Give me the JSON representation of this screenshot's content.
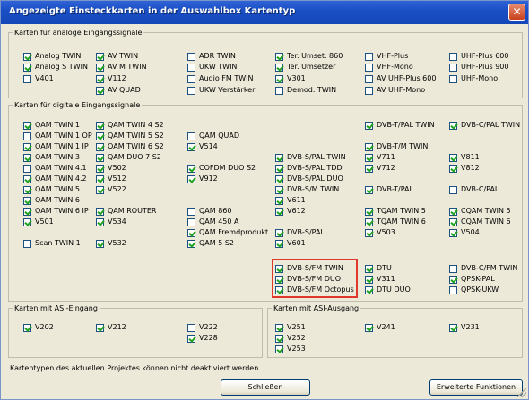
{
  "window": {
    "title": "Angezeigte Einsteckkarten in der Auswahlbox Kartentyp",
    "close_glyph": "✕"
  },
  "groups": {
    "analog": "Karten für analoge Eingangssignale",
    "digital": "Karten für digitale Eingangssignale",
    "asi_in": "Karten mit ASI-Eingang",
    "asi_out": "Karten mit ASI-Ausgang"
  },
  "analog_items": [
    {
      "label": "Analog TWIN",
      "checked": true
    },
    {
      "label": "Analog S TWIN",
      "checked": true
    },
    {
      "label": "V401",
      "checked": false
    },
    {
      "label": "AV TWIN",
      "checked": true
    },
    {
      "label": "AV M TWIN",
      "checked": true
    },
    {
      "label": "V112",
      "checked": true
    },
    {
      "label": "AV QUAD",
      "checked": true
    },
    {
      "label": "ADR TWIN",
      "checked": false
    },
    {
      "label": "UKW TWIN",
      "checked": false
    },
    {
      "label": "Audio FM TWIN",
      "checked": false
    },
    {
      "label": "UKW Verstärker",
      "checked": false
    },
    {
      "label": "Ter. Umset. 860",
      "checked": true
    },
    {
      "label": "Ter. Umsetzer",
      "checked": true
    },
    {
      "label": "V301",
      "checked": true
    },
    {
      "label": "Demod. TWIN",
      "checked": false
    },
    {
      "label": "VHF-Plus",
      "checked": false
    },
    {
      "label": "VHF-Mono",
      "checked": false
    },
    {
      "label": "AV UHF-Plus 600",
      "checked": false
    },
    {
      "label": "AV UHF-Mono",
      "checked": false
    },
    {
      "label": "UHF-Plus 600",
      "checked": false
    },
    {
      "label": "UHF-Plus 900",
      "checked": false
    },
    {
      "label": "UHF-Mono",
      "checked": false
    }
  ],
  "digital_items": [
    {
      "label": "QAM TWIN 1",
      "checked": true
    },
    {
      "label": "QAM TWIN 1 OP",
      "checked": false
    },
    {
      "label": "QAM TWIN 1 IP",
      "checked": true
    },
    {
      "label": "QAM TWIN 3",
      "checked": true
    },
    {
      "label": "QAM TWIN 4.1",
      "checked": false
    },
    {
      "label": "QAM TWIN 4.2",
      "checked": true
    },
    {
      "label": "QAM TWIN 5",
      "checked": true
    },
    {
      "label": "QAM TWIN 6",
      "checked": true
    },
    {
      "label": "QAM TWIN 6 IP",
      "checked": true
    },
    {
      "label": "V501",
      "checked": true
    },
    {
      "label": "Scan TWIN 1",
      "checked": false
    },
    {
      "label": "QAM TWIN 4 S2",
      "checked": true
    },
    {
      "label": "QAM TWIN 5 S2",
      "checked": true
    },
    {
      "label": "QAM TWIN 6 S2",
      "checked": true
    },
    {
      "label": "QAM DUO 7 S2",
      "checked": true
    },
    {
      "label": "V502",
      "checked": true
    },
    {
      "label": "V512",
      "checked": true
    },
    {
      "label": "V522",
      "checked": true
    },
    {
      "label": "QAM ROUTER",
      "checked": true
    },
    {
      "label": "V534",
      "checked": true
    },
    {
      "label": "V532",
      "checked": true
    },
    {
      "label": "QAM QUAD",
      "checked": false
    },
    {
      "label": "V514",
      "checked": true
    },
    {
      "label": "COFDM DUO S2",
      "checked": true
    },
    {
      "label": "V912",
      "checked": true
    },
    {
      "label": "QAM 860",
      "checked": false
    },
    {
      "label": "QAM 450 A",
      "checked": false
    },
    {
      "label": "QAM Fremdprodukt",
      "checked": true
    },
    {
      "label": "QAM 5 S2",
      "checked": true
    },
    {
      "label": "DVB-S/PAL TWIN",
      "checked": true
    },
    {
      "label": "DVB-S/PAL TDD",
      "checked": true
    },
    {
      "label": "DVB-S/PAL DUO",
      "checked": true
    },
    {
      "label": "DVB-S/M TWIN",
      "checked": true
    },
    {
      "label": "V611",
      "checked": true
    },
    {
      "label": "V612",
      "checked": true
    },
    {
      "label": "DVB-S/PAL",
      "checked": true
    },
    {
      "label": "V601",
      "checked": true
    },
    {
      "label": "DVB-S/FM TWIN",
      "checked": true
    },
    {
      "label": "DVB-S/FM DUO",
      "checked": true
    },
    {
      "label": "DVB-S/FM Octopus",
      "checked": true
    },
    {
      "label": "DVB-T/PAL TWIN",
      "checked": true
    },
    {
      "label": "DVB-T/M TWIN",
      "checked": true
    },
    {
      "label": "V711",
      "checked": true
    },
    {
      "label": "V712",
      "checked": true
    },
    {
      "label": "DVB-T/PAL",
      "checked": true
    },
    {
      "label": "TQAM TWIN 5",
      "checked": true
    },
    {
      "label": "TQAM TWIN 6",
      "checked": true
    },
    {
      "label": "V503",
      "checked": true
    },
    {
      "label": "DTU",
      "checked": true
    },
    {
      "label": "V311",
      "checked": true
    },
    {
      "label": "DTU DUO",
      "checked": true
    },
    {
      "label": "DVB-C/PAL TWIN",
      "checked": true
    },
    {
      "label": "V811",
      "checked": true
    },
    {
      "label": "V812",
      "checked": true
    },
    {
      "label": "DVB-C/PAL",
      "checked": false
    },
    {
      "label": "CQAM TWIN 5",
      "checked": true
    },
    {
      "label": "CQAM TWIN 6",
      "checked": true
    },
    {
      "label": "V504",
      "checked": true
    },
    {
      "label": "DVB-C/FM TWIN",
      "checked": false
    },
    {
      "label": "QPSK-PAL",
      "checked": true
    },
    {
      "label": "QPSK-UKW",
      "checked": false
    }
  ],
  "asi_in_items": [
    {
      "label": "V202",
      "checked": true
    },
    {
      "label": "V212",
      "checked": true
    },
    {
      "label": "V222",
      "checked": false
    },
    {
      "label": "V228",
      "checked": true
    }
  ],
  "asi_out_items": [
    {
      "label": "V251",
      "checked": true
    },
    {
      "label": "V252",
      "checked": true
    },
    {
      "label": "V253",
      "checked": true
    },
    {
      "label": "V241",
      "checked": true
    },
    {
      "label": "V231",
      "checked": true
    }
  ],
  "footer": {
    "note": "Kartentypen des aktuellen Projektes können nicht deaktiviert werden.",
    "close_button": "Schließen",
    "advanced_button": "Erweiterte Funktionen"
  },
  "colors": {
    "titlebar": "#1b4fc5",
    "checkmark": "#21a121",
    "highlight": "#e0392b",
    "dialog_bg": "#ece9d8"
  }
}
